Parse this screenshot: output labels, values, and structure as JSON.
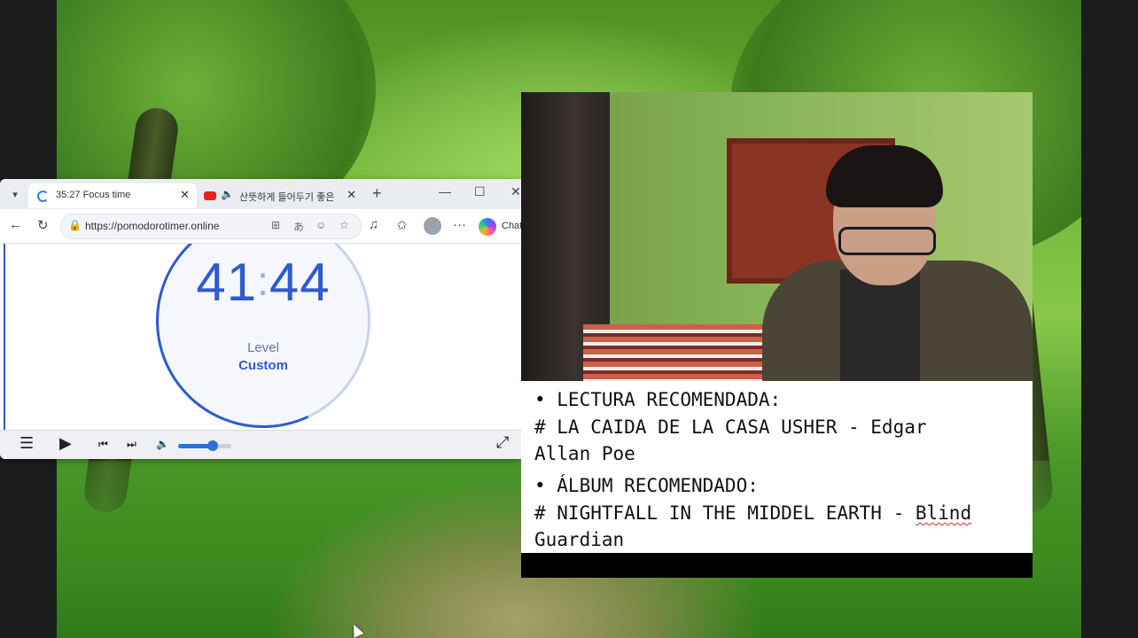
{
  "browser": {
    "tabs": [
      {
        "title": "35:27 Focus time",
        "close": "✕"
      },
      {
        "title": "산뜻하게 들어두기 좋은",
        "close": "✕"
      }
    ],
    "new_tab": "+",
    "window_controls": {
      "minimize": "—",
      "maximize": "☐",
      "close": "✕"
    },
    "url": "https://pomodorotimer.online",
    "copilot_label": "Chat",
    "icons": {
      "back": "←",
      "reload": "↻",
      "more": "···"
    }
  },
  "timer": {
    "minutes": "41",
    "separator": ":",
    "seconds": "44",
    "level_label": "Level",
    "level_value": "Custom"
  },
  "player": {
    "menu": "☰",
    "play": "▶",
    "prev": "⏮",
    "next": "⏭",
    "volume_icon": "🔈",
    "volume_level": 0.65,
    "fullscreen": "⤢"
  },
  "card": {
    "line1": "• LECTURA RECOMENDADA:",
    "line2": "# LA CAIDA DE LA CASA USHER - Edgar",
    "line3": "Allan Poe",
    "line4": "• ÁLBUM RECOMENDADO:",
    "line5_pre": "# NIGHTFALL IN THE MIDDEL EARTH - ",
    "line5_squig": "Blind",
    "line6": "Guardian"
  },
  "colors": {
    "accent": "#2f5bd0",
    "player_bg": "#eef0f4"
  }
}
